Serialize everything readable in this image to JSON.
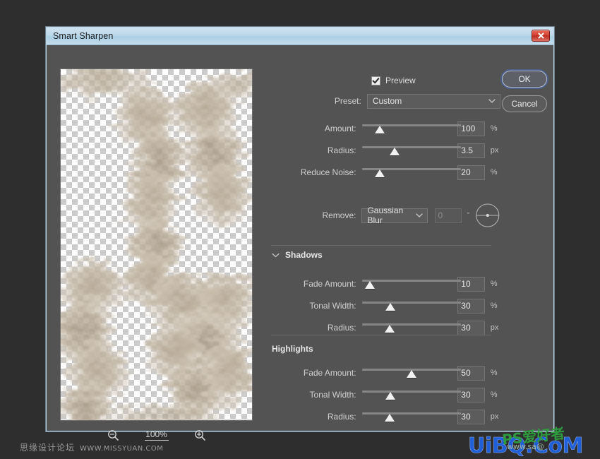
{
  "window": {
    "title": "Smart Sharpen",
    "close_icon": "close-x-icon"
  },
  "preview": {
    "zoom_out_icon": "zoom-out-icon",
    "zoom_in_icon": "zoom-in-icon",
    "zoom_level": "100%"
  },
  "options": {
    "preview_label": "Preview",
    "preview_checked": true,
    "check_icon": "checkmark-icon",
    "gear_icon": "gear-icon",
    "preset_label": "Preset:",
    "preset_value": "Custom",
    "chevron_icon": "chevron-down-icon"
  },
  "main_sliders": [
    {
      "label": "Amount:",
      "value": "100",
      "unit": "%",
      "pct": 18
    },
    {
      "label": "Radius:",
      "value": "3.5",
      "unit": "px",
      "pct": 33
    },
    {
      "label": "Reduce Noise:",
      "value": "20",
      "unit": "%",
      "pct": 18
    }
  ],
  "remove": {
    "label": "Remove:",
    "value": "Gaussian Blur",
    "angle_value": "0",
    "degree_symbol": "°",
    "dial_icon": "angle-dial-icon"
  },
  "shadows": {
    "title": "Shadows",
    "disclosure_icon": "chevron-down-icon",
    "sliders": [
      {
        "label": "Fade Amount:",
        "value": "10",
        "unit": "%",
        "pct": 8
      },
      {
        "label": "Tonal Width:",
        "value": "30",
        "unit": "%",
        "pct": 29
      },
      {
        "label": "Radius:",
        "value": "30",
        "unit": "px",
        "pct": 28
      }
    ]
  },
  "highlights": {
    "title": "Highlights",
    "sliders": [
      {
        "label": "Fade Amount:",
        "value": "50",
        "unit": "%",
        "pct": 50
      },
      {
        "label": "Tonal Width:",
        "value": "30",
        "unit": "%",
        "pct": 29
      },
      {
        "label": "Radius:",
        "value": "30",
        "unit": "px",
        "pct": 28
      }
    ]
  },
  "buttons": {
    "ok": "OK",
    "cancel": "Cancel"
  },
  "watermarks": {
    "left_cn": "思缘设计论坛",
    "left_url": "WWW.MISSYUAN.COM",
    "right_main": "UiBQ.CoM",
    "right_overlay": "PS爱好者",
    "right_sub": "www.sa@"
  },
  "colors": {
    "dialog_bg": "#535353",
    "titlebar": "#bcd8ea",
    "accent_border": "#b9d7ea",
    "close_red": "#d0402f",
    "focus_ring": "#4a5f8a"
  }
}
